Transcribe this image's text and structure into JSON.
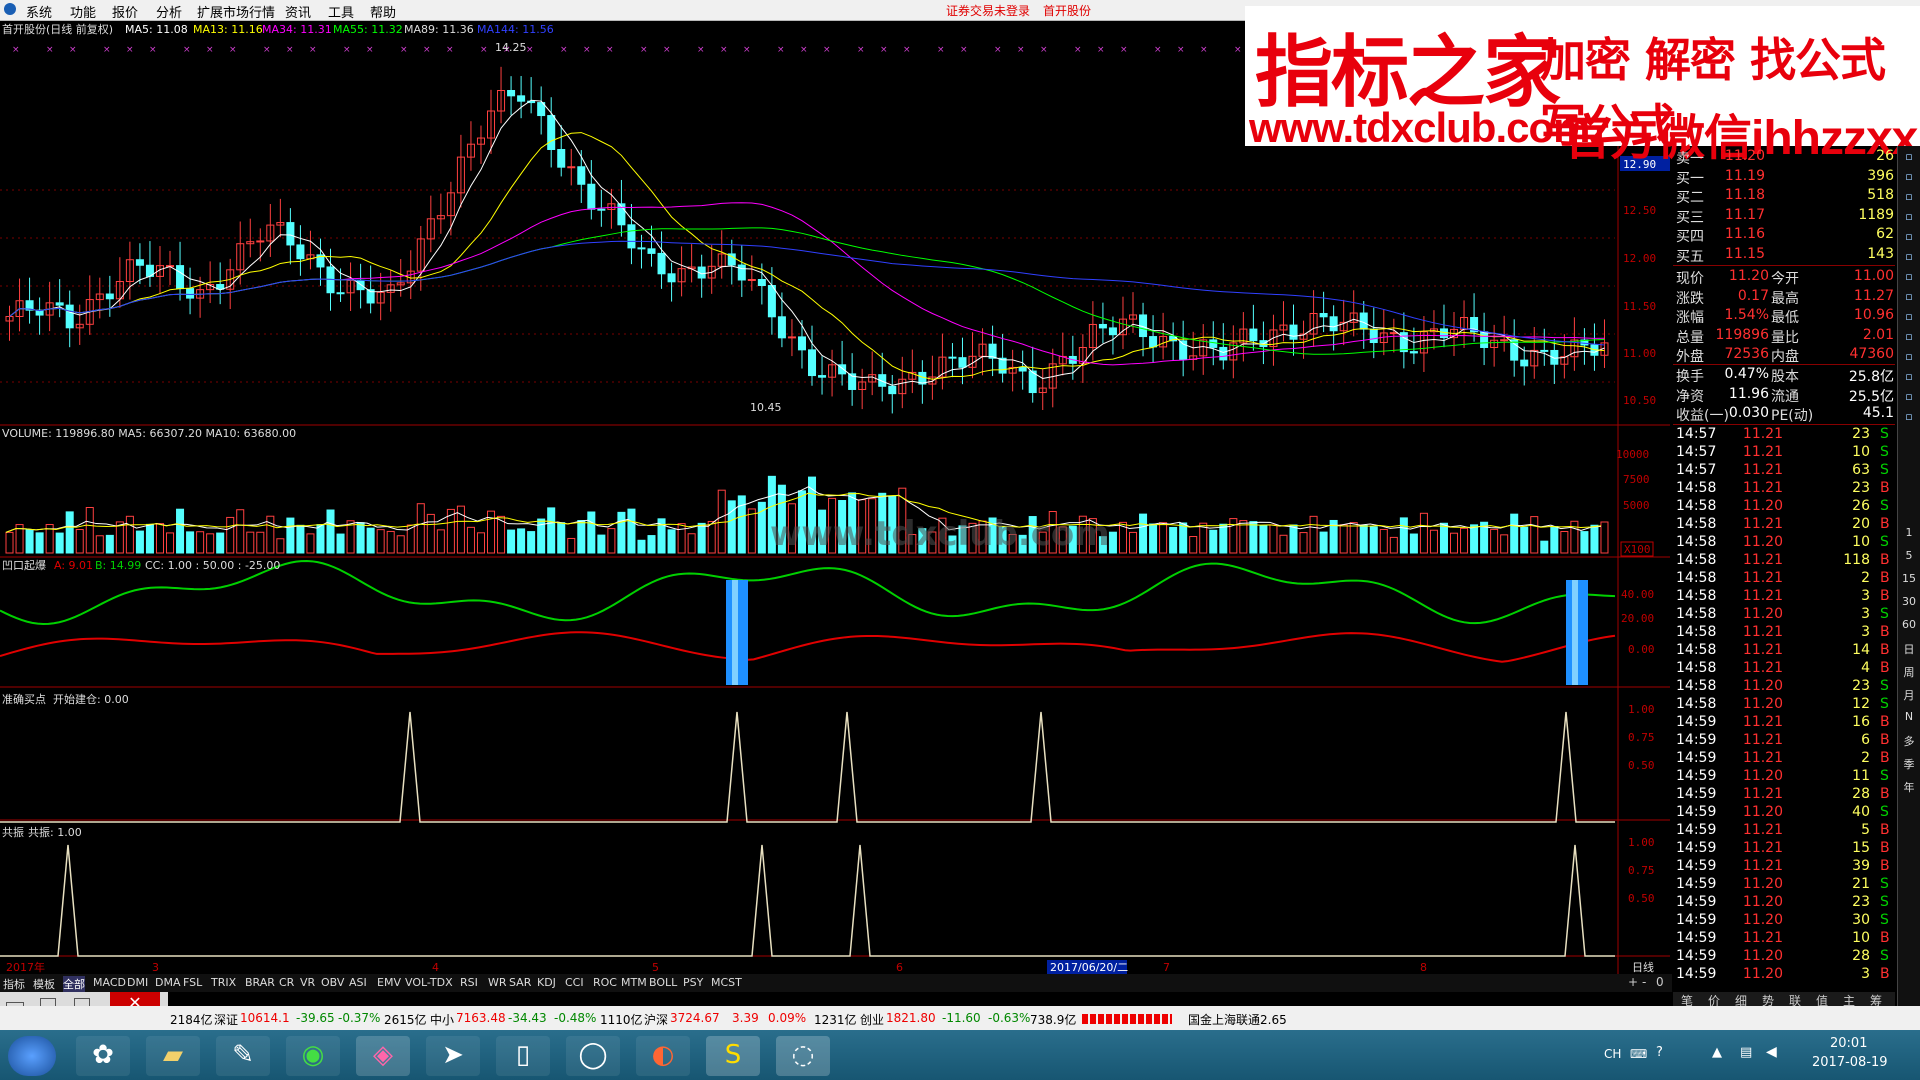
{
  "menu": {
    "items": [
      "系统",
      "功能",
      "报价",
      "分析",
      "扩展市场行情",
      "资讯",
      "工具",
      "帮助"
    ],
    "status1": "证券交易未登录",
    "status2": "首开股份"
  },
  "kline": {
    "title": "首开股份(日线 前复权)",
    "ma5": "MA5: 11.08",
    "ma13": "MA13: 11.16",
    "ma34": "MA34: 11.31",
    "ma55": "MA55: 11.32",
    "ma89": "MA89: 11.36",
    "ma144": "MA144: 11.56",
    "high_mark": "14.25",
    "low_mark": "10.45",
    "yticks": [
      "12.90",
      "12.50",
      "12.00",
      "11.50",
      "11.00",
      "10.50"
    ]
  },
  "volume": {
    "title": "VOLUME: 119896.80  MA5: 66307.20  MA10: 63680.00",
    "yticks": [
      "10000",
      "7500",
      "5000"
    ],
    "unit": "X100"
  },
  "ind1": {
    "name": "凹口起爆",
    "a": "A: 9.01",
    "b": "B: 14.99",
    "cc": "CC: 1.00 : 50.00 : -25.00",
    "yticks": [
      "40.00",
      "20.00",
      "0.00"
    ]
  },
  "ind2": {
    "name": "准确买点",
    "value": "开始建仓: 0.00",
    "yticks": [
      "1.00",
      "0.75",
      "0.50"
    ]
  },
  "ind3": {
    "name": "共振",
    "value": "共振: 1.00",
    "yticks": [
      "1.00",
      "0.75",
      "0.50"
    ]
  },
  "xaxis": {
    "year": "2017年",
    "months": [
      "3",
      "4",
      "5",
      "6",
      "7",
      "8"
    ],
    "cursor_date": "2017/06/20/二",
    "period": "日线"
  },
  "banner": {
    "line1": "指标之家",
    "line2": "加密 解密 找公式 写公式",
    "line3": "www.tdxclub.com",
    "line4": "官方微信ihhzzxx"
  },
  "watermark": "www.tdxclub.com",
  "quote": {
    "price_tag": "12.90",
    "book": [
      {
        "label": "卖一",
        "price": "11.20",
        "vol": "26"
      },
      {
        "label": "买一",
        "price": "11.19",
        "vol": "396"
      },
      {
        "label": "买二",
        "price": "11.18",
        "vol": "518"
      },
      {
        "label": "买三",
        "price": "11.17",
        "vol": "1189"
      },
      {
        "label": "买四",
        "price": "11.16",
        "vol": "62"
      },
      {
        "label": "买五",
        "price": "11.15",
        "vol": "143"
      }
    ],
    "stats": [
      {
        "l1": "现价",
        "v1": "11.20",
        "l2": "今开",
        "v2": "11.00"
      },
      {
        "l1": "涨跌",
        "v1": "0.17",
        "l2": "最高",
        "v2": "11.27"
      },
      {
        "l1": "涨幅",
        "v1": "1.54%",
        "l2": "最低",
        "v2": "10.96"
      },
      {
        "l1": "总量",
        "v1": "119896",
        "l2": "量比",
        "v2": "2.01"
      },
      {
        "l1": "外盘",
        "v1": "72536",
        "l2": "内盘",
        "v2": "47360"
      }
    ],
    "fund": [
      {
        "l1": "换手",
        "v1": "0.47%",
        "l2": "股本",
        "v2": "25.8亿"
      },
      {
        "l1": "净资",
        "v1": "11.96",
        "l2": "流通",
        "v2": "25.5亿"
      },
      {
        "l1": "收益(一)",
        "v1": "0.030",
        "l2": "PE(动)",
        "v2": "45.1"
      }
    ],
    "ticks": [
      [
        "14:57",
        "11.21",
        "23",
        "S"
      ],
      [
        "14:57",
        "11.21",
        "10",
        "S"
      ],
      [
        "14:57",
        "11.21",
        "63",
        "S"
      ],
      [
        "14:58",
        "11.21",
        "23",
        "B"
      ],
      [
        "14:58",
        "11.20",
        "26",
        "S"
      ],
      [
        "14:58",
        "11.21",
        "20",
        "B"
      ],
      [
        "14:58",
        "11.20",
        "10",
        "S"
      ],
      [
        "14:58",
        "11.21",
        "118",
        "B"
      ],
      [
        "14:58",
        "11.21",
        "2",
        "B"
      ],
      [
        "14:58",
        "11.21",
        "3",
        "B"
      ],
      [
        "14:58",
        "11.20",
        "3",
        "S"
      ],
      [
        "14:58",
        "11.21",
        "3",
        "B"
      ],
      [
        "14:58",
        "11.21",
        "14",
        "B"
      ],
      [
        "14:58",
        "11.21",
        "4",
        "B"
      ],
      [
        "14:58",
        "11.20",
        "23",
        "S"
      ],
      [
        "14:58",
        "11.20",
        "12",
        "S"
      ],
      [
        "14:59",
        "11.21",
        "16",
        "B"
      ],
      [
        "14:59",
        "11.21",
        "6",
        "B"
      ],
      [
        "14:59",
        "11.21",
        "2",
        "B"
      ],
      [
        "14:59",
        "11.20",
        "11",
        "S"
      ],
      [
        "14:59",
        "11.21",
        "28",
        "B"
      ],
      [
        "14:59",
        "11.20",
        "40",
        "S"
      ],
      [
        "14:59",
        "11.21",
        "5",
        "B"
      ],
      [
        "14:59",
        "11.21",
        "15",
        "B"
      ],
      [
        "14:59",
        "11.21",
        "39",
        "B"
      ],
      [
        "14:59",
        "11.20",
        "21",
        "S"
      ],
      [
        "14:59",
        "11.20",
        "23",
        "S"
      ],
      [
        "14:59",
        "11.20",
        "30",
        "S"
      ],
      [
        "14:59",
        "11.21",
        "10",
        "B"
      ],
      [
        "14:59",
        "11.20",
        "28",
        "S"
      ],
      [
        "14:59",
        "11.20",
        "3",
        "B"
      ]
    ],
    "bottom_tabs": [
      "笔",
      "价",
      "细",
      "势",
      "联",
      "值",
      "主",
      "筹"
    ]
  },
  "sidebar_labels": [
    "1",
    "5",
    "15",
    "30",
    "60",
    "日",
    "周",
    "月",
    "N",
    "多",
    "季",
    "年"
  ],
  "tabs": [
    "指标",
    "模板",
    "全部",
    "MACD",
    "DMI",
    "DMA",
    "FSL",
    "TRIX",
    "BRAR",
    "CR",
    "VR",
    "OBV",
    "ASI",
    "EMV",
    "VOL-TDX",
    "RSI",
    "WR",
    "SAR",
    "KDJ",
    "CCI",
    "ROC",
    "MTM",
    "BOLL",
    "PSY",
    "MCST"
  ],
  "statusbar": {
    "amt0": "2184亿",
    "sz_label": "深证",
    "sz_val": "10614.1",
    "sz_chg": "-39.65",
    "sz_pct": "-0.37%",
    "sz_amt": "2615亿",
    "zx_label": "中小",
    "zx_val": "7163.48",
    "zx_chg": "-34.43",
    "zx_pct": "-0.48%",
    "zx_amt": "1110亿",
    "hs_label": "沪深",
    "hs_val": "3724.67",
    "hs_chg": "3.39",
    "hs_pct": "0.09%",
    "hs_amt": "1231亿",
    "cy_label": "创业",
    "cy_val": "1821.80",
    "cy_chg": "-11.60",
    "cy_pct": "-0.63%",
    "cy_amt": "738.9亿",
    "news": "国金上海联通2.65"
  },
  "taskbar": {
    "time": "20:01",
    "date": "2017-08-19",
    "ime": "CH"
  },
  "colors": {
    "up": "#ff4040",
    "down": "#54ffff",
    "ma5": "#ffffff",
    "ma13": "#ffff00",
    "ma34": "#ff00ff",
    "ma55": "#00ff00",
    "ma89": "#3040ff",
    "grid": "#7a0000",
    "green": "#00d000",
    "red": "#e00000"
  },
  "chart_data": [
    {
      "type": "candlestick",
      "title": "首开股份(日线 前复权)",
      "ylim": [
        10.4,
        14.4
      ],
      "x": [
        "2017-02",
        "2017-03",
        "2017-04",
        "2017-05",
        "2017-06",
        "2017-07",
        "2017-08"
      ],
      "close_path": [
        11.55,
        11.6,
        11.5,
        11.9,
        12.1,
        11.95,
        11.8,
        12.2,
        12.5,
        12.3,
        12.0,
        11.85,
        11.7,
        12.4,
        13.2,
        13.8,
        14.0,
        13.5,
        13.0,
        12.6,
        12.1,
        12.05,
        12.2,
        12.0,
        11.5,
        11.1,
        10.9,
        10.7,
        10.8,
        11.05,
        11.1,
        11.0,
        10.8,
        11.1,
        11.3,
        11.45,
        11.35,
        11.2,
        11.1,
        11.3,
        11.45,
        11.5,
        11.4,
        11.35,
        11.3,
        11.4,
        11.3,
        11.2,
        11.15,
        11.1,
        11.2
      ]
    },
    {
      "type": "area",
      "name": "凹口起爆",
      "ylim": [
        -5,
        50
      ],
      "series": [
        {
          "name": "A"
        },
        {
          "name": "B"
        }
      ]
    },
    {
      "type": "line",
      "name": "准确买点",
      "values": [
        0,
        0,
        1,
        0,
        1,
        1,
        0,
        1,
        0,
        1
      ],
      "ylim": [
        0,
        1
      ]
    },
    {
      "type": "line",
      "name": "共振",
      "values": [
        1,
        0,
        1,
        1,
        0,
        1
      ],
      "ylim": [
        0,
        1
      ]
    }
  ]
}
